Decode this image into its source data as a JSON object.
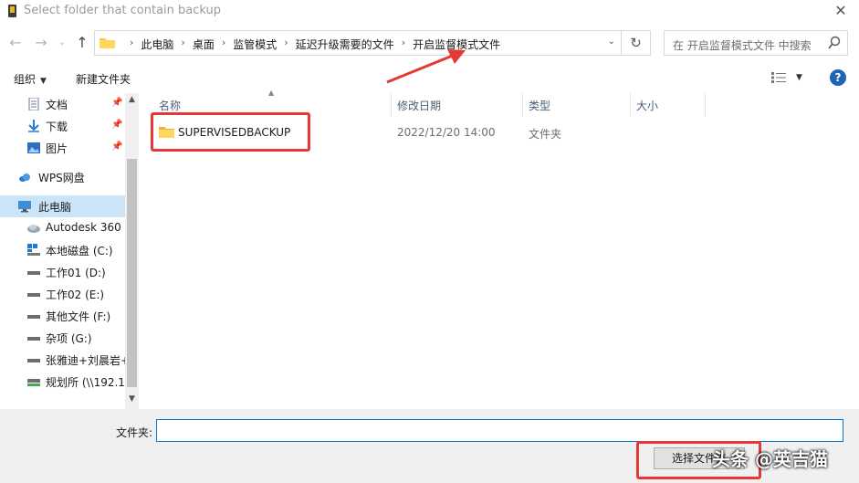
{
  "window": {
    "title": "Select folder that contain backup",
    "close_glyph": "✕"
  },
  "address": {
    "crumbs": [
      "此电脑",
      "桌面",
      "监管模式",
      "延迟升级需要的文件",
      "开启监督模式文件"
    ],
    "search_placeholder": "在 开启监督模式文件 中搜索"
  },
  "toolbar": {
    "organize_label": "组织",
    "new_folder_label": "新建文件夹"
  },
  "nav": {
    "items": [
      {
        "label": "文档",
        "icon": "document-icon",
        "pinned": true
      },
      {
        "label": "下载",
        "icon": "download-icon",
        "pinned": true
      },
      {
        "label": "图片",
        "icon": "pictures-icon",
        "pinned": true
      },
      {
        "label": "WPS网盘",
        "icon": "cloud-icon",
        "pinned": false
      },
      {
        "label": "此电脑",
        "icon": "computer-icon",
        "pinned": false,
        "selected": true
      },
      {
        "label": "Autodesk 360",
        "icon": "autodesk-icon",
        "pinned": false
      },
      {
        "label": "本地磁盘 (C:)",
        "icon": "windows-drive-icon",
        "pinned": false
      },
      {
        "label": "工作01 (D:)",
        "icon": "drive-icon",
        "pinned": false
      },
      {
        "label": "工作02 (E:)",
        "icon": "drive-icon",
        "pinned": false
      },
      {
        "label": "其他文件 (F:)",
        "icon": "drive-icon",
        "pinned": false
      },
      {
        "label": "杂项 (G:)",
        "icon": "drive-icon",
        "pinned": false
      },
      {
        "label": "张雅迪+刘晨岩+",
        "icon": "drive-icon",
        "pinned": false
      },
      {
        "label": "规划所 (\\\\192.1",
        "icon": "network-drive-icon",
        "pinned": false
      }
    ]
  },
  "columns": {
    "name": "名称",
    "date": "修改日期",
    "type": "类型",
    "size": "大小"
  },
  "files": [
    {
      "name": "SUPERVISEDBACKUP",
      "date": "2022/12/20 14:00",
      "type": "文件夹",
      "size": ""
    }
  ],
  "bottom": {
    "folder_label": "文件夹:",
    "folder_value": "",
    "select_button": "选择文件夹"
  },
  "watermark": "头条 @英吉猫",
  "colors": {
    "highlight": "#e53935",
    "selection": "#cce4f7",
    "folder": "#f4c84a",
    "help": "#1f63b5"
  }
}
